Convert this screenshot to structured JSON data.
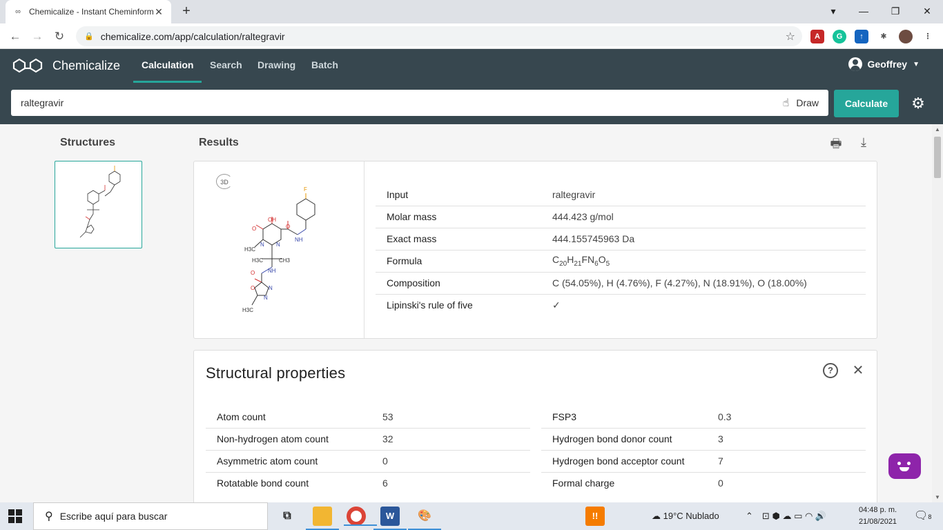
{
  "browser": {
    "tab_title": "Chemicalize - Instant Cheminform",
    "url": "chemicalize.com/app/calculation/raltegravir"
  },
  "app": {
    "brand": "Chemicalize",
    "nav": [
      "Calculation",
      "Search",
      "Drawing",
      "Batch"
    ],
    "active_nav": "Calculation",
    "user": "Geoffrey",
    "search_value": "raltegravir",
    "draw_label": "Draw",
    "calculate_label": "Calculate"
  },
  "structures_title": "Structures",
  "results_title": "Results",
  "badge_3d": "3D",
  "results": {
    "input_label": "Input",
    "input_value": "raltegravir",
    "molar_label": "Molar mass",
    "molar_value": "444.423 g/mol",
    "exact_label": "Exact mass",
    "exact_value": "444.155745963 Da",
    "formula_label": "Formula",
    "formula_parts": [
      "C",
      "20",
      "H",
      "21",
      "FN",
      "6",
      "O",
      "5"
    ],
    "composition_label": "Composition",
    "composition_value": "C (54.05%), H (4.76%), F (4.27%), N (18.91%), O (18.00%)",
    "lipinski_label": "Lipinski's rule of five",
    "lipinski_value": "✓"
  },
  "structural": {
    "title": "Structural properties",
    "left": [
      {
        "k": "Atom count",
        "v": "53"
      },
      {
        "k": "Non-hydrogen atom count",
        "v": "32"
      },
      {
        "k": "Asymmetric atom count",
        "v": "0"
      },
      {
        "k": "Rotatable bond count",
        "v": "6"
      }
    ],
    "right": [
      {
        "k": "FSP3",
        "v": "0.3"
      },
      {
        "k": "Hydrogen bond donor count",
        "v": "3"
      },
      {
        "k": "Hydrogen bond acceptor count",
        "v": "7"
      },
      {
        "k": "Formal charge",
        "v": "0"
      }
    ]
  },
  "molecule_labels": {
    "F": "F",
    "OH": "OH",
    "O": "O",
    "N": "N",
    "NH": "NH",
    "H": "H",
    "CH3": "CH3",
    "H3C": "H3C"
  },
  "taskbar": {
    "search_placeholder": "Escribe aquí para buscar",
    "weather": "19°C  Nublado",
    "time": "04:48 p. m.",
    "date": "21/08/2021",
    "notif_count": "8"
  }
}
